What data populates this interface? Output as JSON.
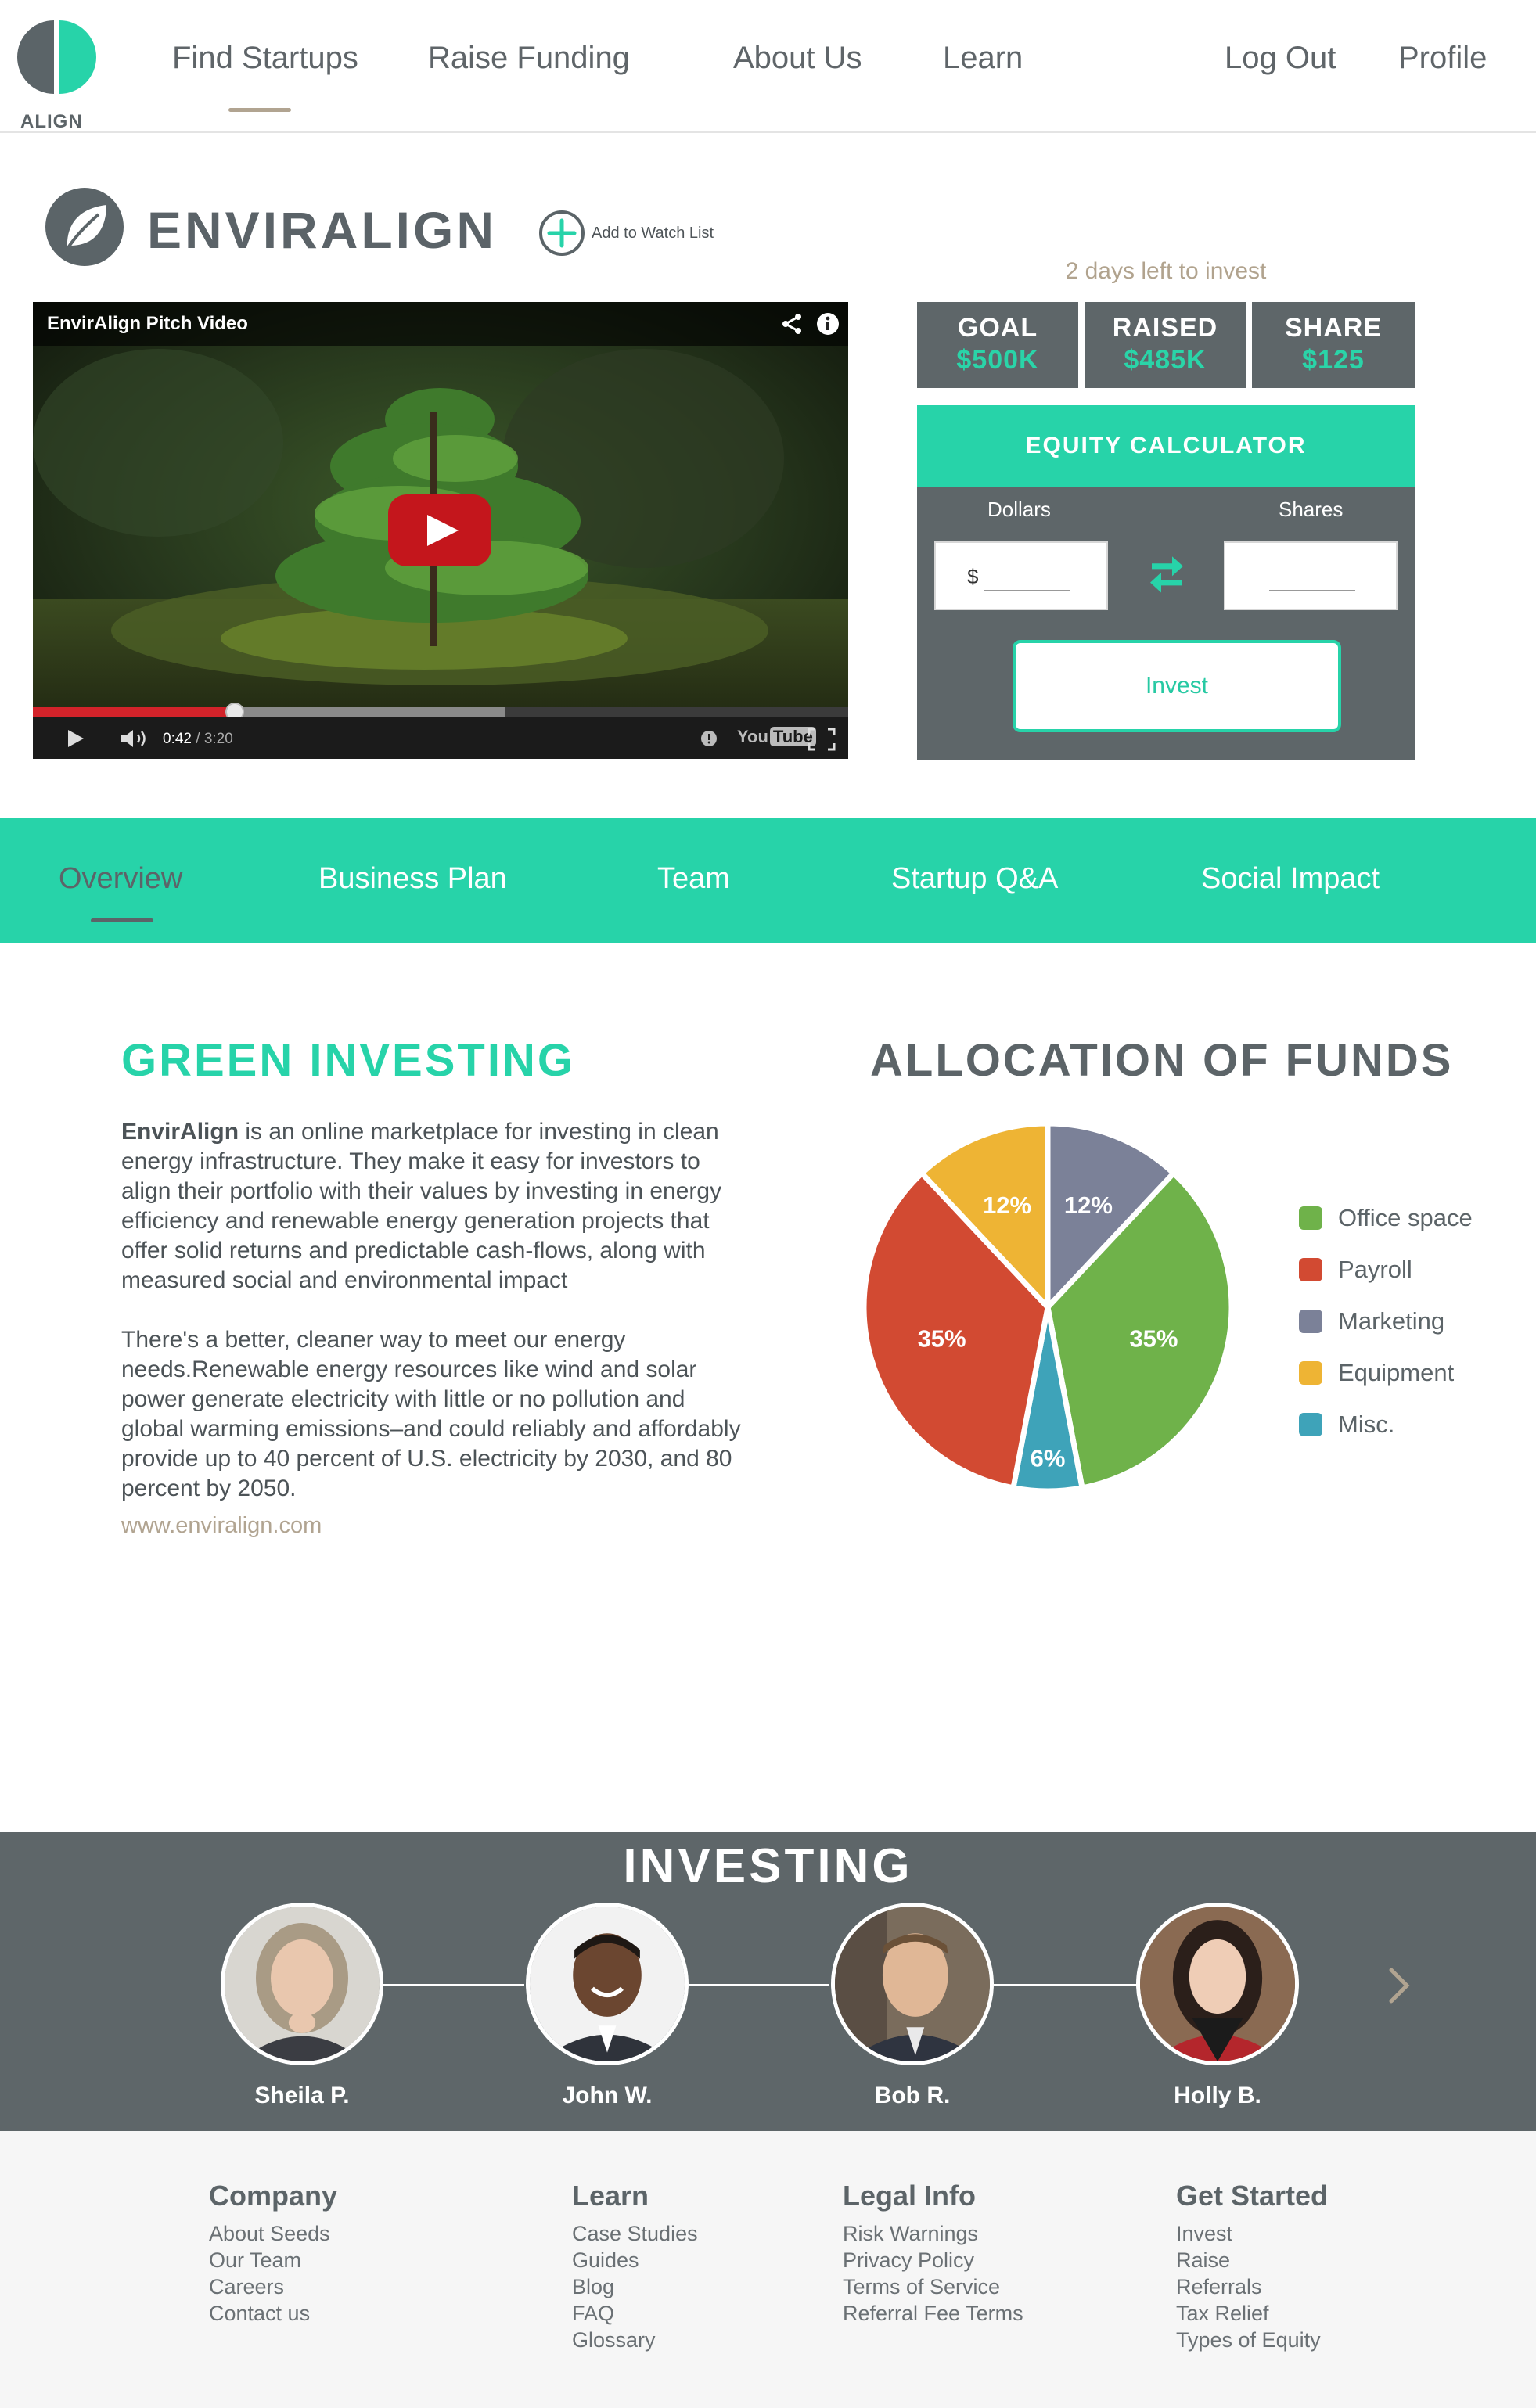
{
  "nav": {
    "logo_text": "ALIGN",
    "items": [
      {
        "label": "Find Startups",
        "active": true
      },
      {
        "label": "Raise Funding"
      },
      {
        "label": "About Us"
      },
      {
        "label": "Learn"
      },
      {
        "label": "Log Out"
      },
      {
        "label": "Profile"
      }
    ]
  },
  "startup": {
    "name": "ENVIRALIGN",
    "watch_label": "Add to Watch List"
  },
  "video": {
    "title": "EnvirAlign Pitch Video",
    "current_time": "0:42",
    "duration": "/ 3:20",
    "played_fraction": 0.248,
    "loaded_fraction": 0.58,
    "youtube_label": "You",
    "youtube_label_2": "Tube"
  },
  "invest": {
    "days_left": "2 days left to invest",
    "stats": [
      {
        "label": "GOAL",
        "value": "$500K"
      },
      {
        "label": "RAISED",
        "value": "$485K"
      },
      {
        "label": "SHARE",
        "value": "$125"
      }
    ],
    "calculator_title": "EQUITY CALCULATOR",
    "dollars_label": "Dollars",
    "shares_label": "Shares",
    "dollar_sign": "$",
    "invest_button": "Invest"
  },
  "tabs": [
    {
      "label": "Overview",
      "active": true
    },
    {
      "label": "Business Plan"
    },
    {
      "label": "Team"
    },
    {
      "label": "Startup Q&A"
    },
    {
      "label": "Social Impact"
    }
  ],
  "overview": {
    "title": "GREEN INVESTING",
    "para1_bold": "EnvirAlign",
    "para1_rest": " is an online marketplace for investing in clean energy infrastructure. They make it easy for investors to align their portfolio with their values by investing in energy efficiency and renewable energy generation projects that offer solid returns and predictable cash-flows, along with measured social and environmental impact",
    "para2": "There's a better, cleaner way to meet our energy needs.Renewable energy resources like wind and solar power generate electricity with little or no pollution and global warming emissions–and could reliably and affordably provide up to 40 percent of U.S. electricity by 2030, and 80 percent by 2050.",
    "website": "www.enviralign.com"
  },
  "allocation_title": "ALLOCATION OF FUNDS",
  "chart_data": {
    "type": "pie",
    "title": "ALLOCATION OF FUNDS",
    "slices": [
      {
        "name": "Marketing",
        "value": 12,
        "label": "12%",
        "color": "#7b8198"
      },
      {
        "name": "Office space",
        "value": 35,
        "label": "35%",
        "color": "#6fb24a"
      },
      {
        "name": "Misc.",
        "value": 6,
        "label": "6%",
        "color": "#3ea3b9"
      },
      {
        "name": "Payroll",
        "value": 35,
        "label": "35%",
        "color": "#d24a32"
      },
      {
        "name": "Equipment",
        "value": 12,
        "label": "12%",
        "color": "#eeb434"
      }
    ],
    "legend": [
      {
        "name": "Office space",
        "color": "#6fb24a"
      },
      {
        "name": "Payroll",
        "color": "#d24a32"
      },
      {
        "name": "Marketing",
        "color": "#7b8198"
      },
      {
        "name": "Equipment",
        "color": "#eeb434"
      },
      {
        "name": "Misc.",
        "color": "#3ea3b9"
      }
    ],
    "legend_position": "right"
  },
  "investors": {
    "title": "INVESTING",
    "people": [
      {
        "name": "Sheila P."
      },
      {
        "name": "John W."
      },
      {
        "name": "Bob R."
      },
      {
        "name": "Holly B."
      }
    ]
  },
  "footer": {
    "columns": [
      {
        "heading": "Company",
        "links": [
          "About Seeds",
          "Our Team",
          "Careers",
          "Contact us"
        ]
      },
      {
        "heading": "Learn",
        "links": [
          "Case Studies",
          "Guides",
          "Blog",
          "FAQ",
          "Glossary"
        ]
      },
      {
        "heading": "Legal Info",
        "links": [
          "Risk Warnings",
          "Privacy Policy",
          "Terms of Service",
          "Referral Fee Terms"
        ]
      },
      {
        "heading": "Get Started",
        "links": [
          "Invest",
          "Raise",
          "Referrals",
          "Tax Relief",
          "Types of Equity"
        ]
      }
    ]
  },
  "colors": {
    "accent": "#27d3a9",
    "slate": "#5e6669",
    "tan": "#b1a491",
    "video_red": "#d3232a"
  }
}
